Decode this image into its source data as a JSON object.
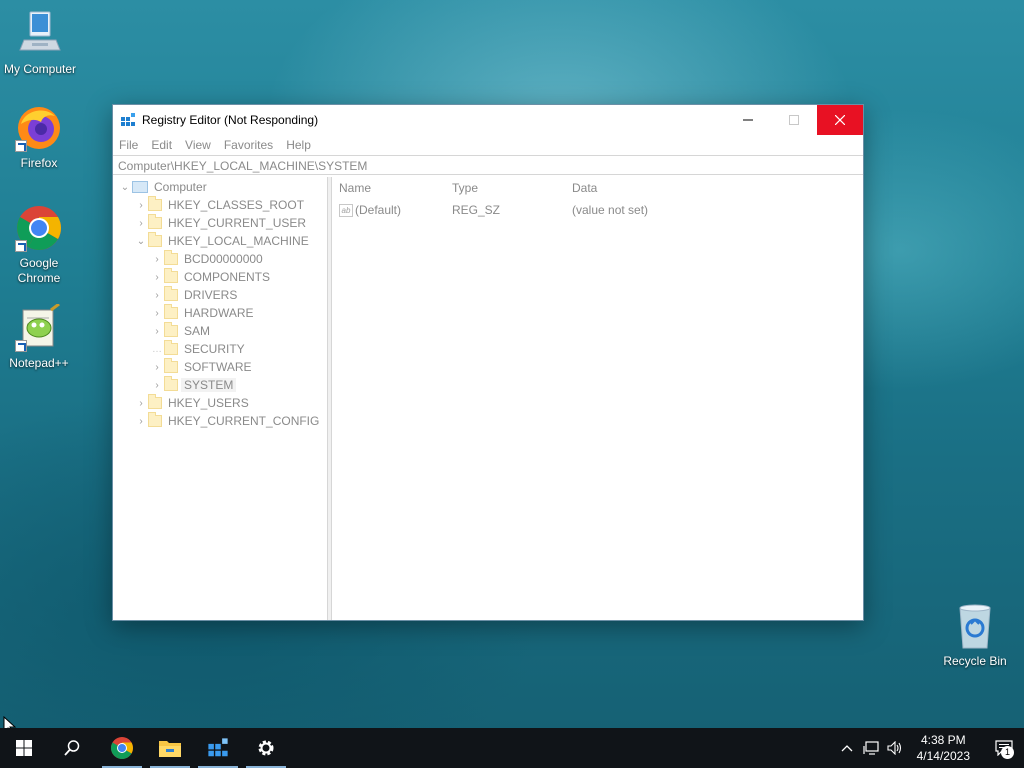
{
  "desktop": {
    "icons": [
      {
        "label": "My Computer"
      },
      {
        "label": "Firefox"
      },
      {
        "label": "Google\nChrome"
      },
      {
        "label": "Notepad++"
      },
      {
        "label": "Recycle Bin"
      }
    ]
  },
  "window": {
    "title": "Registry Editor (Not Responding)",
    "menu": [
      "File",
      "Edit",
      "View",
      "Favorites",
      "Help"
    ],
    "address": "Computer\\HKEY_LOCAL_MACHINE\\SYSTEM",
    "tree": {
      "root": "Computer",
      "hives": [
        "HKEY_CLASSES_ROOT",
        "HKEY_CURRENT_USER",
        "HKEY_LOCAL_MACHINE"
      ],
      "hklm_children": [
        "BCD00000000",
        "COMPONENTS",
        "DRIVERS",
        "HARDWARE",
        "SAM",
        "SECURITY",
        "SOFTWARE",
        "SYSTEM"
      ],
      "more_hives": [
        "HKEY_USERS",
        "HKEY_CURRENT_CONFIG"
      ]
    },
    "list": {
      "columns": [
        "Name",
        "Type",
        "Data"
      ],
      "rows": [
        {
          "name": "(Default)",
          "type": "REG_SZ",
          "data": "(value not set)"
        }
      ]
    }
  },
  "taskbar": {
    "time": "4:38 PM",
    "date": "4/14/2023",
    "notification_count": "1"
  },
  "colors": {
    "close_red": "#e81123",
    "taskbar": "#101418",
    "folder": "#fdf0c4"
  }
}
